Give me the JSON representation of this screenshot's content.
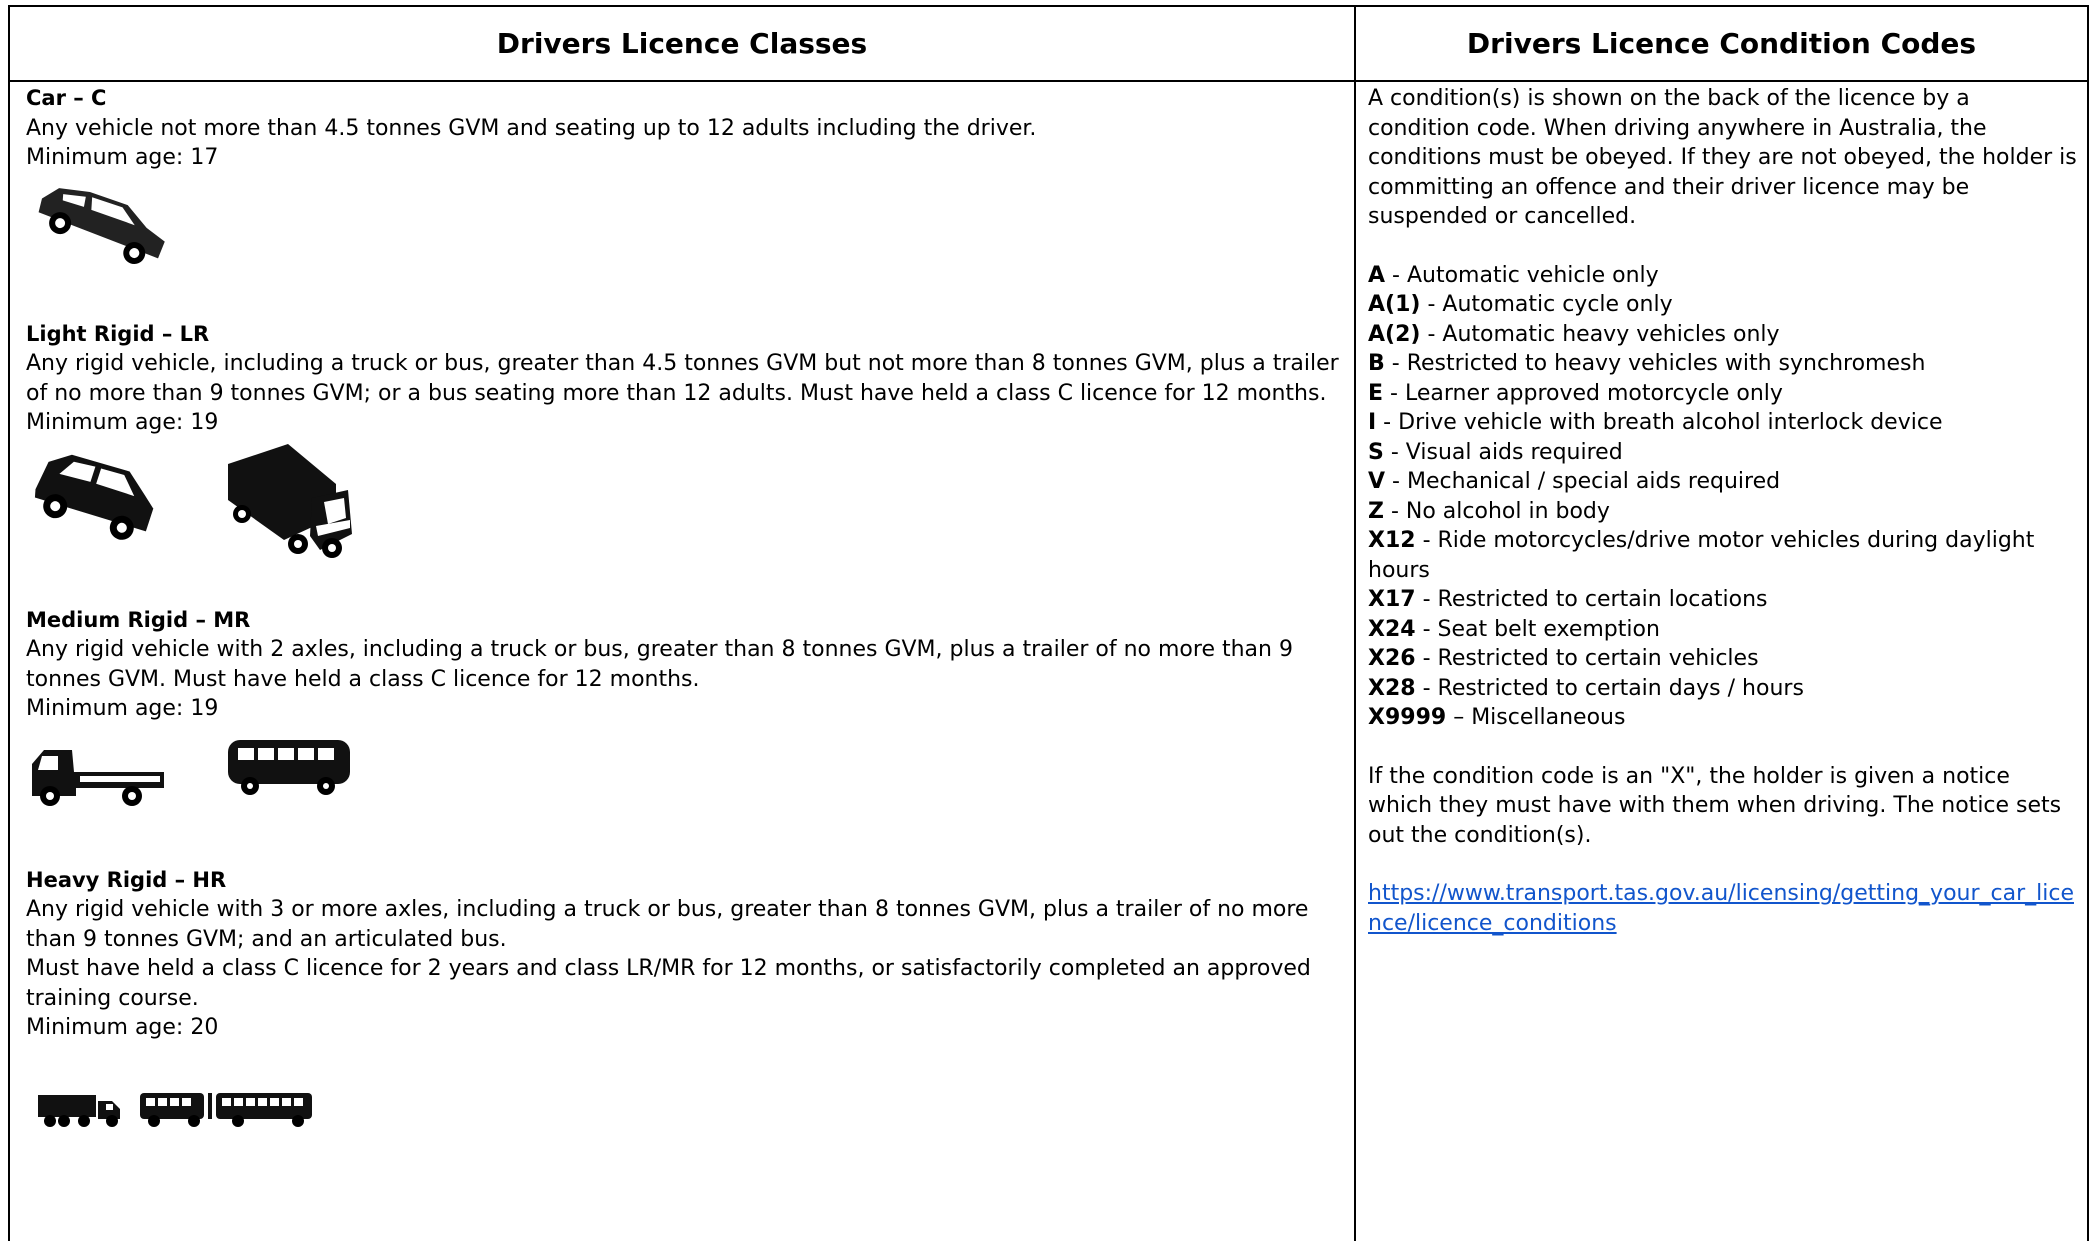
{
  "headers": {
    "classes": "Drivers Licence Classes",
    "conditions": "Drivers Licence Condition Codes"
  },
  "classes": [
    {
      "title": "Car – C",
      "desc": "Any vehicle not more than 4.5 tonnes GVM and seating up to 12 adults including the driver.",
      "age": "Minimum age: 17",
      "icons": [
        "car-icon"
      ]
    },
    {
      "title": "Light Rigid – LR",
      "desc": "Any rigid vehicle, including a truck or bus, greater than 4.5 tonnes GVM but not more than 8 tonnes GVM, plus a trailer of no more than 9 tonnes GVM; or a bus seating more than 12 adults. Must have held a class C licence for 12 months.",
      "age": "Minimum age: 19",
      "icons": [
        "van-icon",
        "box-truck-icon"
      ]
    },
    {
      "title": "Medium Rigid – MR",
      "desc": "Any rigid vehicle with 2 axles, including a truck or bus, greater than 8 tonnes GVM, plus a trailer of no more than 9 tonnes GVM. Must have held a class C licence for 12 months.",
      "age": "Minimum age: 19",
      "icons": [
        "flatbed-truck-icon",
        "bus-icon"
      ]
    },
    {
      "title": "Heavy Rigid – HR",
      "desc": "Any rigid vehicle with 3 or more axles, including a truck or bus, greater than 8 tonnes GVM, plus a trailer of no more than 9 tonnes GVM; and an articulated bus.",
      "desc2": "Must have held a class C licence for 2 years and class LR/MR for 12 months, or satisfactorily completed an approved training course.",
      "age": "Minimum age: 20",
      "icons": [
        "heavy-truck-icon",
        "articulated-bus-icon"
      ]
    }
  ],
  "conditions": {
    "intro": "A condition(s) is shown on the back of the licence by a condition code. When driving anywhere in Australia, the conditions must be obeyed. If they are not obeyed, the holder is committing an offence and their driver licence may be suspended or cancelled.",
    "codes": [
      {
        "code": "A",
        "sep": " - ",
        "text": "Automatic vehicle only"
      },
      {
        "code": "A(1)",
        "sep": " - ",
        "text": "Automatic cycle only"
      },
      {
        "code": "A(2)",
        "sep": " - ",
        "text": "Automatic heavy vehicles only"
      },
      {
        "code": "B",
        "sep": " - ",
        "text": "Restricted to heavy vehicles with synchromesh"
      },
      {
        "code": "E",
        "sep": " - ",
        "text": "Learner approved motorcycle only"
      },
      {
        "code": "I",
        "sep": " - ",
        "text": "Drive vehicle with breath alcohol interlock device"
      },
      {
        "code": "S",
        "sep": " - ",
        "text": "Visual aids required"
      },
      {
        "code": "V",
        "sep": " - ",
        "text": "Mechanical / special aids required"
      },
      {
        "code": "Z",
        "sep": " - ",
        "text": "No alcohol in body"
      },
      {
        "code": "X12",
        "sep": " - ",
        "text": "Ride motorcycles/drive motor vehicles during daylight hours"
      },
      {
        "code": "X17",
        "sep": " - ",
        "text": "Restricted to certain locations"
      },
      {
        "code": "X24",
        "sep": " - ",
        "text": "Seat belt exemption"
      },
      {
        "code": "X26",
        "sep": " - ",
        "text": "Restricted to certain vehicles"
      },
      {
        "code": "X28",
        "sep": " - ",
        "text": "Restricted to certain days / hours"
      },
      {
        "code": "X9999",
        "sep": " – ",
        "text": "Miscellaneous"
      }
    ],
    "notice": "If the condition code is an \"X\", the holder is given a notice which they must have with them when driving. The notice sets out the condition(s).",
    "link": "https://www.transport.tas.gov.au/licensing/getting_your_car_licence/licence_conditions"
  }
}
